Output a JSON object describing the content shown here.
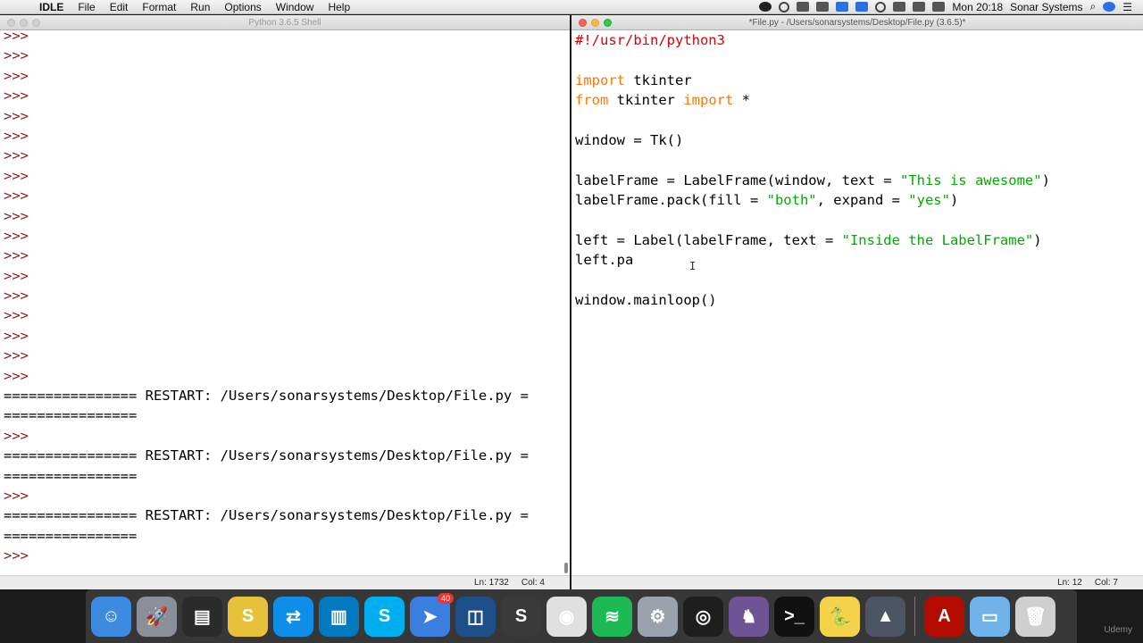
{
  "menubar": {
    "apple": "",
    "items": [
      "IDLE",
      "File",
      "Edit",
      "Format",
      "Run",
      "Options",
      "Window",
      "Help"
    ],
    "clock": "Mon 20:18",
    "user": "Sonar Systems"
  },
  "shell": {
    "title": "Python 3.6.5 Shell",
    "lines": [
      ">>>",
      ">>>",
      ">>>",
      ">>>",
      ">>>",
      ">>>",
      ">>>",
      ">>>",
      ">>>",
      ">>>",
      ">>>",
      ">>>",
      ">>>",
      ">>>",
      ">>>",
      ">>>",
      ">>>",
      ">>>",
      "================ RESTART: /Users/sonarsystems/Desktop/File.py =",
      "================",
      ">>>",
      "================ RESTART: /Users/sonarsystems/Desktop/File.py =",
      "================",
      ">>>",
      "================ RESTART: /Users/sonarsystems/Desktop/File.py =",
      "================",
      ">>>"
    ],
    "status_ln": "Ln: 1732",
    "status_col": "Col: 4"
  },
  "editor": {
    "title": "*File.py - /Users/sonarsystems/Desktop/File.py (3.6.5)*",
    "code": {
      "shebang": "#!/usr/bin/python3",
      "l3_kw": "import",
      "l3_rest": " tkinter",
      "l4_kw1": "from",
      "l4_mid": " tkinter ",
      "l4_kw2": "import",
      "l4_rest": " *",
      "l6": "window = Tk()",
      "l8_a": "labelFrame = LabelFrame(window, text = ",
      "l8_s": "\"This is awesome\"",
      "l8_b": ")",
      "l9_a": "labelFrame.pack(fill = ",
      "l9_s1": "\"both\"",
      "l9_m": ", expand = ",
      "l9_s2": "\"yes\"",
      "l9_b": ")",
      "l11_a": "left = Label(labelFrame, text = ",
      "l11_s": "\"Inside the LabelFrame\"",
      "l11_b": ")",
      "l12": "left.pa",
      "l14": "window.mainloop()"
    },
    "status_ln": "Ln: 12",
    "status_col": "Col: 7"
  },
  "cursor_glyph": "I",
  "dock": {
    "apps": [
      {
        "name": "Finder",
        "color": "#3d8be0"
      },
      {
        "name": "Launchpad",
        "color": "#8a8f99"
      },
      {
        "name": "Activity Monitor",
        "color": "#2b2b2b"
      },
      {
        "name": "Scrivener",
        "color": "#e7c13a"
      },
      {
        "name": "TeamViewer",
        "color": "#0e8ee9"
      },
      {
        "name": "Trello",
        "color": "#0079bf"
      },
      {
        "name": "Skype",
        "color": "#00aff0"
      },
      {
        "name": "Airmail",
        "color": "#3a7fe0",
        "badge": "40"
      },
      {
        "name": "Screens",
        "color": "#1d4f88"
      },
      {
        "name": "Sublime Text",
        "color": "#3a3a3a"
      },
      {
        "name": "Chrome",
        "color": "#e0e0e0"
      },
      {
        "name": "Spotify",
        "color": "#1db954"
      },
      {
        "name": "System Preferences",
        "color": "#9aa3ad"
      },
      {
        "name": "OBS",
        "color": "#1e1e1e"
      },
      {
        "name": "GitHub Desktop",
        "color": "#6e5494"
      },
      {
        "name": "Terminal",
        "color": "#111111"
      },
      {
        "name": "Python Launcher",
        "color": "#f3d34a"
      },
      {
        "name": "Rocket",
        "color": "#4b5563"
      }
    ],
    "right_apps": [
      {
        "name": "Acrobat Reader",
        "color": "#b30b00"
      },
      {
        "name": "Downloads Folder",
        "color": "#6fb3ea"
      },
      {
        "name": "Trash",
        "color": "#cfcfcf"
      }
    ],
    "glyphs": {
      "Finder": "☺",
      "Launchpad": "🚀",
      "Activity Monitor": "▤",
      "Scrivener": "S",
      "TeamViewer": "⇄",
      "Trello": "▥",
      "Skype": "S",
      "Airmail": "➤",
      "Screens": "◫",
      "Sublime Text": "S",
      "Chrome": "◉",
      "Spotify": "≋",
      "System Preferences": "⚙",
      "OBS": "◎",
      "GitHub Desktop": "♞",
      "Terminal": ">_",
      "Python Launcher": "🐍",
      "Rocket": "▲",
      "Acrobat Reader": "A",
      "Downloads Folder": "▭",
      "Trash": "🗑"
    }
  },
  "watermark": "Udemy"
}
